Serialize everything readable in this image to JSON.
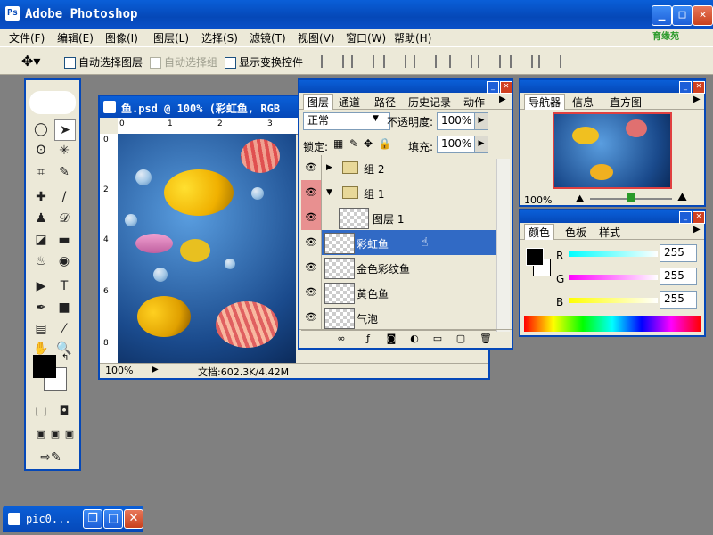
{
  "window": {
    "title": "Adobe Photoshop",
    "min": "_",
    "max": "□",
    "close": "✕"
  },
  "menu": [
    "文件(F)",
    "编辑(E)",
    "图像(I)",
    "图层(L)",
    "选择(S)",
    "滤镜(T)",
    "视图(V)",
    "窗口(W)",
    "帮助(H)"
  ],
  "logo_text": "育缘苑",
  "options": {
    "auto_select_layer": "自动选择图层",
    "auto_select_group": "自动选择组",
    "show_transform": "显示变换控件"
  },
  "document": {
    "title": "鱼.psd @ 100% (彩虹鱼, RGB",
    "zoom": "100%",
    "status": "文档:602.3K/4.42M",
    "ruler_h": [
      "0",
      "1",
      "2",
      "3"
    ],
    "ruler_v": [
      "0",
      "2",
      "4",
      "6",
      "8"
    ]
  },
  "layers_panel": {
    "tabs": [
      "图层",
      "通道",
      "路径",
      "历史记录",
      "动作"
    ],
    "blend_mode": "正常",
    "opacity_label": "不透明度:",
    "opacity": "100%",
    "lock_label": "锁定:",
    "fill_label": "填充:",
    "fill": "100%",
    "layers": [
      {
        "name": "组 2",
        "kind": "group"
      },
      {
        "name": "组 1",
        "kind": "group"
      },
      {
        "name": "图层 1",
        "kind": "layer"
      },
      {
        "name": "彩虹鱼",
        "kind": "layer",
        "selected": true
      },
      {
        "name": "金色彩纹鱼",
        "kind": "layer"
      },
      {
        "name": "黄色鱼",
        "kind": "layer"
      },
      {
        "name": "气泡",
        "kind": "layer"
      }
    ]
  },
  "navigator": {
    "tabs": [
      "导航器",
      "信息",
      "直方图"
    ],
    "zoom": "100%"
  },
  "color_panel": {
    "tabs": [
      "颜色",
      "色板",
      "样式"
    ],
    "channels": [
      {
        "label": "R",
        "value": "255"
      },
      {
        "label": "G",
        "value": "255"
      },
      {
        "label": "B",
        "value": "255"
      }
    ]
  },
  "taskbar": {
    "title": "pic0..."
  },
  "colors": {
    "xp_blue": "#0548b8",
    "panel_bg": "#ece9d8",
    "selection": "#316ac5"
  }
}
